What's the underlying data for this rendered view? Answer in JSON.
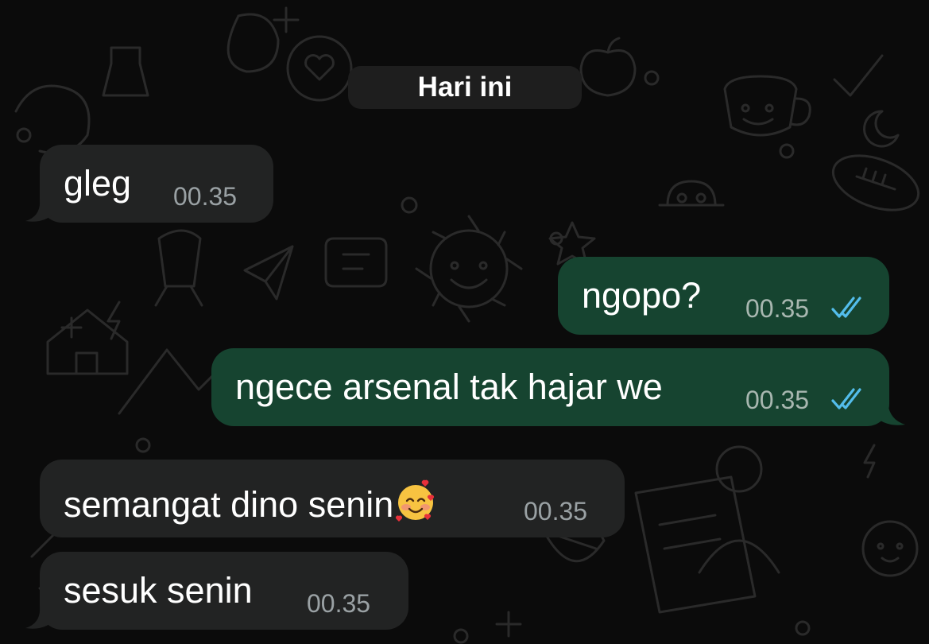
{
  "date_divider": "Hari ini",
  "messages": [
    {
      "direction": "incoming",
      "text": "gleg",
      "time": "00.35"
    },
    {
      "direction": "outgoing",
      "text": "ngopo?",
      "time": "00.35",
      "status": "read"
    },
    {
      "direction": "outgoing",
      "text": "ngece arsenal tak hajar we",
      "time": "00.35",
      "status": "read"
    },
    {
      "direction": "incoming",
      "text": "semangat dino senin",
      "emoji": "smiling-face-with-hearts",
      "time": "00.35"
    },
    {
      "direction": "incoming",
      "text": "sesuk senin",
      "time": "00.35"
    }
  ],
  "colors": {
    "background": "#0b0b0b",
    "incoming_bubble": "#222323",
    "outgoing_bubble": "#164430",
    "read_ticks": "#53bdeb",
    "doodle": "#2a2a2a"
  }
}
